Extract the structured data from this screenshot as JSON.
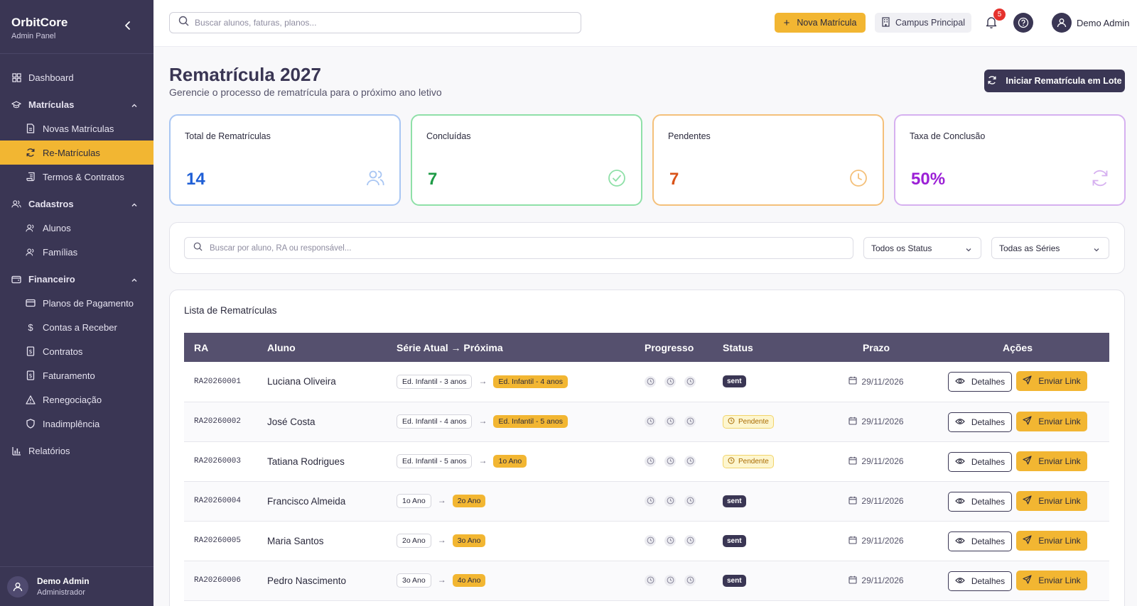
{
  "brand": {
    "title": "OrbitCore",
    "subtitle": "Admin Panel"
  },
  "sidebar": {
    "dashboard": "Dashboard",
    "matriculas": {
      "label": "Matrículas",
      "items": [
        "Novas Matrículas",
        "Re-Matrículas",
        "Termos & Contratos"
      ]
    },
    "cadastros": {
      "label": "Cadastros",
      "items": [
        "Alunos",
        "Famílias"
      ]
    },
    "financeiro": {
      "label": "Financeiro",
      "items": [
        "Planos de Pagamento",
        "Contas a Receber",
        "Contratos",
        "Faturamento",
        "Renegociação",
        "Inadimplência"
      ]
    },
    "relatorios": "Relatórios",
    "active": "Re-Matrículas",
    "user": {
      "name": "Demo Admin",
      "role": "Administrador"
    }
  },
  "header": {
    "search_placeholder": "Buscar alunos, faturas, planos...",
    "new_button": "Nova Matrícula",
    "campus_button": "Campus Principal",
    "notification_count": "5",
    "user_name": "Demo Admin"
  },
  "page": {
    "title": "Rematrícula 2027",
    "subtitle": "Gerencie o processo de rematrícula para o próximo ano letivo",
    "batch_button": "Iniciar Rematrícula em Lote"
  },
  "stats": [
    {
      "label": "Total de Rematrículas",
      "value": "14",
      "color": "#1f5fd6",
      "border": "#a9c6f3",
      "icon": "users-icon"
    },
    {
      "label": "Concluídas",
      "value": "7",
      "color": "#1e9b46",
      "border": "#8fe0a8",
      "icon": "check-circle-icon"
    },
    {
      "label": "Pendentes",
      "value": "7",
      "color": "#d9541a",
      "border": "#f4c07a",
      "icon": "clock-icon"
    },
    {
      "label": "Taxa de Conclusão",
      "value": "50%",
      "color": "#9b1fd6",
      "border": "#d6b0f0",
      "icon": "refresh-icon"
    }
  ],
  "filters": {
    "search_placeholder": "Buscar por aluno, RA ou responsável...",
    "status_select": "Todos os Status",
    "series_select": "Todas as Séries"
  },
  "list": {
    "title": "Lista de Rematrículas",
    "columns": [
      "RA",
      "Aluno",
      "Série Atual → Próxima",
      "Progresso",
      "Status",
      "Prazo",
      "Ações"
    ],
    "details_label": "Detalhes",
    "send_label": "Enviar Link",
    "rows": [
      {
        "ra": "RA20260001",
        "aluno": "Luciana Oliveira",
        "serie_atual": "Ed. Infantil - 3 anos",
        "serie_proxima": "Ed. Infantil - 4 anos",
        "status": "sent",
        "prazo": "29/11/2026"
      },
      {
        "ra": "RA20260002",
        "aluno": "José Costa",
        "serie_atual": "Ed. Infantil - 4 anos",
        "serie_proxima": "Ed. Infantil - 5 anos",
        "status": "Pendente",
        "prazo": "29/11/2026"
      },
      {
        "ra": "RA20260003",
        "aluno": "Tatiana Rodrigues",
        "serie_atual": "Ed. Infantil - 5 anos",
        "serie_proxima": "1o Ano",
        "status": "Pendente",
        "prazo": "29/11/2026"
      },
      {
        "ra": "RA20260004",
        "aluno": "Francisco Almeida",
        "serie_atual": "1o Ano",
        "serie_proxima": "2o Ano",
        "status": "sent",
        "prazo": "29/11/2026"
      },
      {
        "ra": "RA20260005",
        "aluno": "Maria Santos",
        "serie_atual": "2o Ano",
        "serie_proxima": "3o Ano",
        "status": "sent",
        "prazo": "29/11/2026"
      },
      {
        "ra": "RA20260006",
        "aluno": "Pedro Nascimento",
        "serie_atual": "3o Ano",
        "serie_proxima": "4o Ano",
        "status": "sent",
        "prazo": "29/11/2026"
      }
    ]
  }
}
